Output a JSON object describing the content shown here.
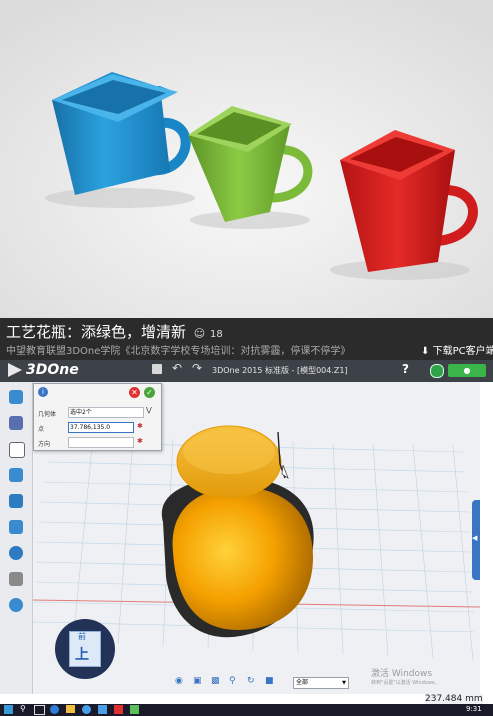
{
  "header": {
    "title": "工艺花瓶：添绿色，增清新",
    "view_count": "18",
    "subtitle": "中望教育联盟3DOne学院《北京数字学校专场培训：对抗雾霾，停课不停学》",
    "download_label": "下载PC客户端"
  },
  "app": {
    "logo": "3DOne",
    "title": "3DOne 2015 标准版 - [模型004.Z1]",
    "help_label": "?"
  },
  "panel": {
    "row1_label": "几何体",
    "row1_value": "选中2个",
    "row2_label": "点",
    "row2_value": "37.786,135.0",
    "row3_label": "方向",
    "row3_value": ""
  },
  "viewcube": {
    "top_label": "上",
    "front_label": "前"
  },
  "statusbar": {
    "filter_value": "全部",
    "measurement": "237.484 mm",
    "watermark_line1": "激活 Windows",
    "watermark_line2": "转到\"设置\"以激活 Windows。",
    "clock": "9:31"
  },
  "colors": {
    "blue_cup": "#1f8fd0",
    "green_cup": "#7fbd3a",
    "red_cup": "#d9201f",
    "vase_orange": "#f5a100",
    "toolbar_bg": "#3d4248"
  }
}
